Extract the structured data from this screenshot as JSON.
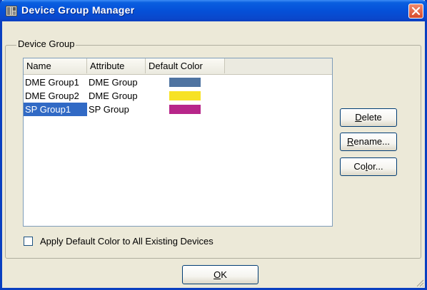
{
  "window": {
    "title": "Device Group Manager",
    "icon": "app-icon",
    "close_icon": "close-icon"
  },
  "group_box": {
    "legend": "Device Group"
  },
  "list": {
    "columns": [
      "Name",
      "Attribute",
      "Default Color"
    ],
    "rows": [
      {
        "name": "DME Group1",
        "attribute": "DME Group",
        "color": "#4f74a1",
        "selected": false
      },
      {
        "name": "DME Group2",
        "attribute": "DME Group",
        "color": "#f7e225",
        "selected": false
      },
      {
        "name": "SP Group1",
        "attribute": "SP Group",
        "color": "#b7268a",
        "selected": true
      }
    ]
  },
  "buttons": {
    "delete": {
      "label": "Delete",
      "mnemonic": "D",
      "rest": "elete"
    },
    "rename": {
      "label": "Rename...",
      "mnemonic": "R",
      "rest": "ename..."
    },
    "color": {
      "label": "Color...",
      "pre": "Co",
      "mnemonic": "l",
      "rest": "or..."
    },
    "ok": {
      "label": "OK",
      "mnemonic": "O",
      "rest": "K"
    }
  },
  "checkbox": {
    "label": "Apply Default Color to All Existing Devices",
    "checked": false
  },
  "colors": {
    "titlebar": "#0a5fe0",
    "selection": "#316ac5",
    "dialog_bg": "#ece9d8"
  }
}
